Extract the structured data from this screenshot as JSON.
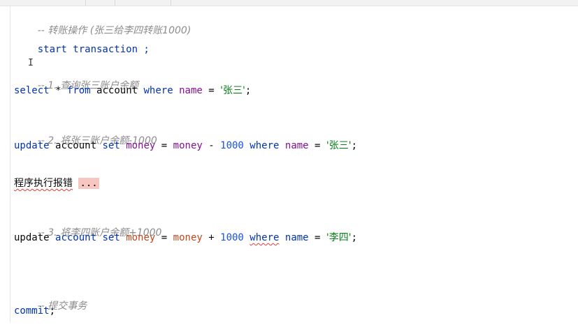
{
  "code": {
    "comment_transfer": "-- 转账操作 (张三给李四转账1000)",
    "start_transaction": "start transaction ;",
    "comment_1": "-- 1. 查询张三账户余额",
    "select_kw": "select",
    "select_star": "*",
    "from_kw": "from",
    "table_account": "account",
    "where_kw": "where",
    "name_col": "name",
    "eq": "=",
    "str_zhangsan": "'张三'",
    "semicolon": ";",
    "comment_2": "-- 2. 将张三账户余额-1000",
    "update_kw": "update",
    "set_kw": "set",
    "money_col": "money",
    "minus": "-",
    "plus": "+",
    "num_1000": "1000",
    "error_text": "程序执行报错",
    "error_dots": "...",
    "comment_3": "-- 3. 将李四账户余额+1000",
    "str_lisi": "'李四'",
    "comment_commit": "-- 提交事务",
    "commit_kw": "commit",
    "cursor_glyph": "I"
  },
  "colors": {
    "keyword": "#0033b3",
    "table": "#871094",
    "column": "#c4451b",
    "string": "#067d17",
    "number": "#1750eb",
    "comment": "#8c8c8c",
    "error_highlight": "#f7c6c0"
  }
}
